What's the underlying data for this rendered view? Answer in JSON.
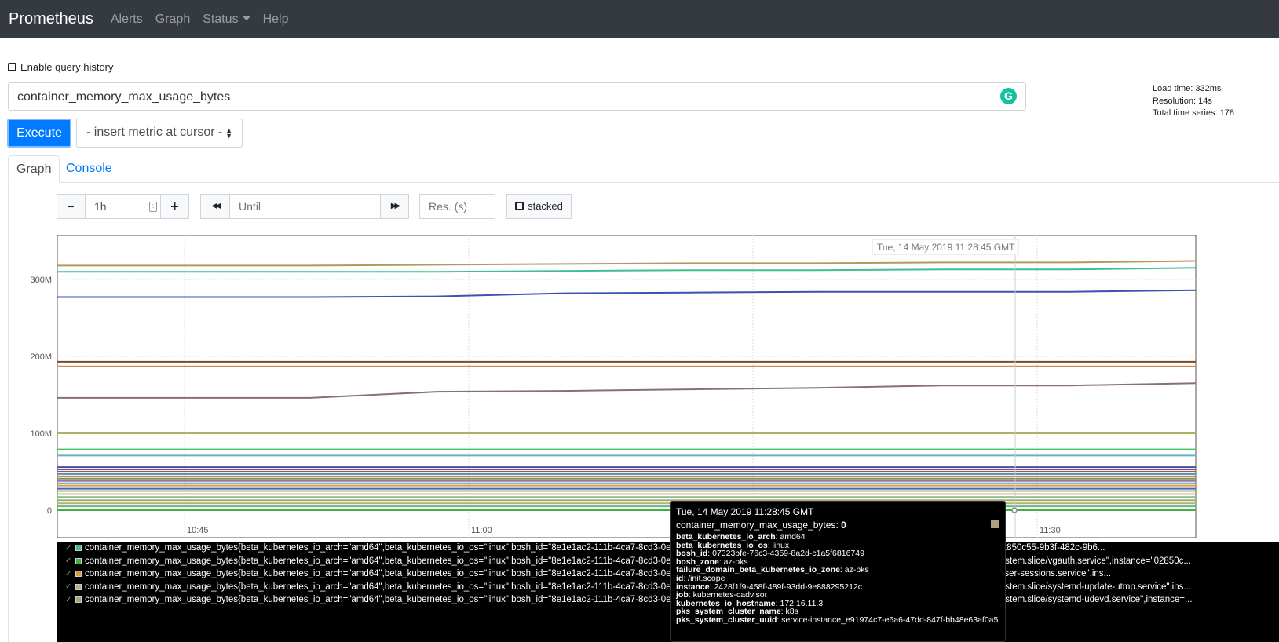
{
  "nav": {
    "brand": "Prometheus",
    "items": [
      "Alerts",
      "Graph",
      "Status",
      "Help"
    ]
  },
  "history": {
    "label": "Enable query history"
  },
  "query": {
    "value": "container_memory_max_usage_bytes",
    "grammarly": "G"
  },
  "stats": {
    "load": "Load time: 332ms",
    "resolution": "Resolution: 14s",
    "total": "Total time series: 178"
  },
  "execute": "Execute",
  "metric_select": "- insert metric at cursor -",
  "tabs": {
    "graph": "Graph",
    "console": "Console"
  },
  "controls": {
    "minus": "−",
    "range": "1h",
    "plus": "+",
    "back": "◀◀",
    "until": "Until",
    "fwd": "▶▶",
    "res": "Res. (s)",
    "stacked": "stacked"
  },
  "chart_data": {
    "type": "line",
    "x_ticks": [
      "10:45",
      "11:00",
      "11:30"
    ],
    "y_ticks": [
      "300M",
      "200M",
      "100M",
      "0"
    ],
    "ylim": [
      0,
      350000000
    ],
    "grid": true,
    "series": [
      {
        "color": "#b09a5e",
        "values": [
          318000000,
          318000000,
          318000000,
          319000000,
          320000000,
          321000000,
          321000000,
          322000000,
          322000000,
          324000000
        ]
      },
      {
        "color": "#3fbf8f",
        "values": [
          310000000,
          310000000,
          310000000,
          310000000,
          311000000,
          312000000,
          312000000,
          313000000,
          313000000,
          315000000
        ]
      },
      {
        "color": "#3b52b0",
        "values": [
          277000000,
          277000000,
          277000000,
          278000000,
          282000000,
          283000000,
          284000000,
          284000000,
          284000000,
          286000000
        ]
      },
      {
        "color": "#7a4a2a",
        "values": [
          193000000,
          193000000,
          193000000,
          193000000,
          193000000,
          193000000,
          193000000,
          193000000,
          193000000,
          193000000
        ]
      },
      {
        "color": "#d08a4a",
        "values": [
          187000000,
          187000000,
          187000000,
          187000000,
          187000000,
          187000000,
          187000000,
          187000000,
          187000000,
          187000000
        ]
      },
      {
        "color": "#8a7070",
        "values": [
          146000000,
          146000000,
          146000000,
          154000000,
          155000000,
          157000000,
          159000000,
          162000000,
          162000000,
          165000000
        ]
      },
      {
        "color": "#b0b060",
        "values": [
          100000000,
          100000000,
          100000000,
          100000000,
          100000000,
          100000000,
          100000000,
          100000000,
          100000000,
          100000000
        ]
      },
      {
        "color": "#3fbf5f",
        "values": [
          79000000,
          79000000,
          79000000,
          79000000,
          79000000,
          79000000,
          79000000,
          79000000,
          79000000,
          79000000
        ]
      },
      {
        "color": "#6ab0c0",
        "values": [
          71000000,
          71000000,
          71000000,
          71000000,
          71000000,
          71000000,
          71000000,
          71000000,
          71000000,
          71000000
        ]
      },
      {
        "color": "#4a5090",
        "values": [
          56000000,
          56000000,
          56000000,
          56000000,
          56000000,
          56000000,
          56000000,
          56000000,
          56000000,
          56000000
        ]
      },
      {
        "color": "#7050a0",
        "values": [
          53000000,
          53000000,
          53000000,
          53000000,
          53000000,
          53000000,
          53000000,
          53000000,
          53000000,
          53000000
        ]
      },
      {
        "color": "#b05050",
        "values": [
          50000000,
          50000000,
          50000000,
          50000000,
          50000000,
          50000000,
          50000000,
          50000000,
          50000000,
          50000000
        ]
      },
      {
        "color": "#5090b0",
        "values": [
          47000000,
          47000000,
          47000000,
          47000000,
          47000000,
          47000000,
          47000000,
          47000000,
          47000000,
          47000000
        ]
      },
      {
        "color": "#c07050",
        "values": [
          44000000,
          44000000,
          44000000,
          44000000,
          44000000,
          44000000,
          44000000,
          44000000,
          44000000,
          44000000
        ]
      },
      {
        "color": "#809050",
        "values": [
          41000000,
          41000000,
          41000000,
          41000000,
          41000000,
          41000000,
          41000000,
          41000000,
          41000000,
          41000000
        ]
      },
      {
        "color": "#a070b0",
        "values": [
          38000000,
          38000000,
          38000000,
          38000000,
          38000000,
          38000000,
          38000000,
          38000000,
          38000000,
          38000000
        ]
      },
      {
        "color": "#50a090",
        "values": [
          35000000,
          35000000,
          35000000,
          35000000,
          35000000,
          35000000,
          35000000,
          35000000,
          35000000,
          35000000
        ]
      },
      {
        "color": "#d0a040",
        "values": [
          32000000,
          32000000,
          32000000,
          32000000,
          32000000,
          32000000,
          32000000,
          32000000,
          32000000,
          32000000
        ]
      },
      {
        "color": "#5060c0",
        "values": [
          28000000,
          28000000,
          28000000,
          28000000,
          28000000,
          28000000,
          28000000,
          28000000,
          28000000,
          28000000
        ]
      },
      {
        "color": "#90b070",
        "values": [
          25000000,
          25000000,
          25000000,
          25000000,
          25000000,
          25000000,
          25000000,
          25000000,
          25000000,
          25000000
        ]
      },
      {
        "color": "#c0c070",
        "values": [
          21000000,
          21000000,
          21000000,
          21000000,
          21000000,
          21000000,
          21000000,
          21000000,
          21000000,
          21000000
        ]
      },
      {
        "color": "#80c080",
        "values": [
          17000000,
          17000000,
          17000000,
          17000000,
          17000000,
          17000000,
          17000000,
          17000000,
          17000000,
          17000000
        ]
      },
      {
        "color": "#b0a080",
        "values": [
          13000000,
          13000000,
          13000000,
          13000000,
          13000000,
          13000000,
          13000000,
          13000000,
          13000000,
          13000000
        ]
      },
      {
        "color": "#a0c060",
        "values": [
          9000000,
          9000000,
          9000000,
          9000000,
          9000000,
          9000000,
          9000000,
          9000000,
          9000000,
          9000000
        ]
      },
      {
        "color": "#70b090",
        "values": [
          5000000,
          5000000,
          5000000,
          5000000,
          5000000,
          5000000,
          5000000,
          5000000,
          5000000,
          5000000
        ]
      },
      {
        "color": "#40b040",
        "values": [
          0,
          0,
          0,
          0,
          0,
          0,
          0,
          0,
          0,
          0
        ]
      }
    ]
  },
  "hover_date": "Tue, 14 May 2019 11:28:45 GMT",
  "tooltip": {
    "date": "Tue, 14 May 2019 11:28:45 GMT",
    "metric": "container_memory_max_usage_bytes:",
    "value": "0",
    "labels": [
      {
        "k": "beta_kubernetes_io_arch",
        "v": "amd64"
      },
      {
        "k": "beta_kubernetes_io_os",
        "v": "linux"
      },
      {
        "k": "bosh_id",
        "v": "07323bfe-76c3-4359-8a2d-c1a5f6816749"
      },
      {
        "k": "bosh_zone",
        "v": "az-pks"
      },
      {
        "k": "failure_domain_beta_kubernetes_io_zone",
        "v": "az-pks"
      },
      {
        "k": "id",
        "v": "/init.scope"
      },
      {
        "k": "instance",
        "v": "2428f1f9-458f-489f-93dd-9e888295212c"
      },
      {
        "k": "job",
        "v": "kubernetes-cadvisor"
      },
      {
        "k": "kubernetes_io_hostname",
        "v": "172.16.11.3"
      },
      {
        "k": "pks_system_cluster_name",
        "v": "k8s"
      },
      {
        "k": "pks_system_cluster_uuid",
        "v": "service-instance_e91974c7-e6a6-47dd-847f-bb48e63af0a5"
      }
    ]
  },
  "legend": [
    {
      "color": "#3fbf8f",
      "text": "container_memory_max_usage_bytes{beta_kubernetes_io_arch=\"amd64\",beta_kubernetes_io_os=\"linux\",bosh_id=\"8e1e1ac2-111b-4ca7-8cd3-0e...\",failure_domain_beta_kubernetes_io_zone=\"az-pks\",id=\"/user.slice\",instance=\"02850c55-9b3f-482c-9b6..."
    },
    {
      "color": "#40b040",
      "text": "container_memory_max_usage_bytes{beta_kubernetes_io_arch=\"amd64\",beta_kubernetes_io_os=\"linux\",bosh_id=\"8e1e1ac2-111b-4ca7-8cd3-0e...\",bosh_zone=\"az-pks\",failure_domain_beta_kubernetes_io_zone=\"az-pks\",id=\"/system.slice/vgauth.service\",instance=\"02850c..."
    },
    {
      "color": "#d0a040",
      "text": "container_memory_max_usage_bytes{beta_kubernetes_io_arch=\"amd64\",beta_kubernetes_io_os=\"linux\",bosh_id=\"8e1e1ac2-111b-4ca7-8cd3-0e...\",failure_domain_beta_kubernetes_io_zone=\"az-pks\",id=\"/system.slice/systemd-user-sessions.service\",ins..."
    },
    {
      "color": "#c0b070",
      "text": "container_memory_max_usage_bytes{beta_kubernetes_io_arch=\"amd64\",beta_kubernetes_io_os=\"linux\",bosh_id=\"8e1e1ac2-111b-4ca7-8cd3-0e...\",bosh_zone=\"az-pks\",failure_domain_beta_kubernetes_io_zone=\"az-pks\",id=\"/system.slice/systemd-update-utmp.service\",ins..."
    },
    {
      "color": "#a8a37b",
      "text": "container_memory_max_usage_bytes{beta_kubernetes_io_arch=\"amd64\",beta_kubernetes_io_os=\"linux\",bosh_id=\"8e1e1ac2-111b-4ca7-8cd3-0e...\",bosh_zone=\"az-pks\",failure_domain_beta_kubernetes_io_zone=\"az-pks\",id=\"/system.slice/systemd-udevd.service\",instance=..."
    }
  ]
}
